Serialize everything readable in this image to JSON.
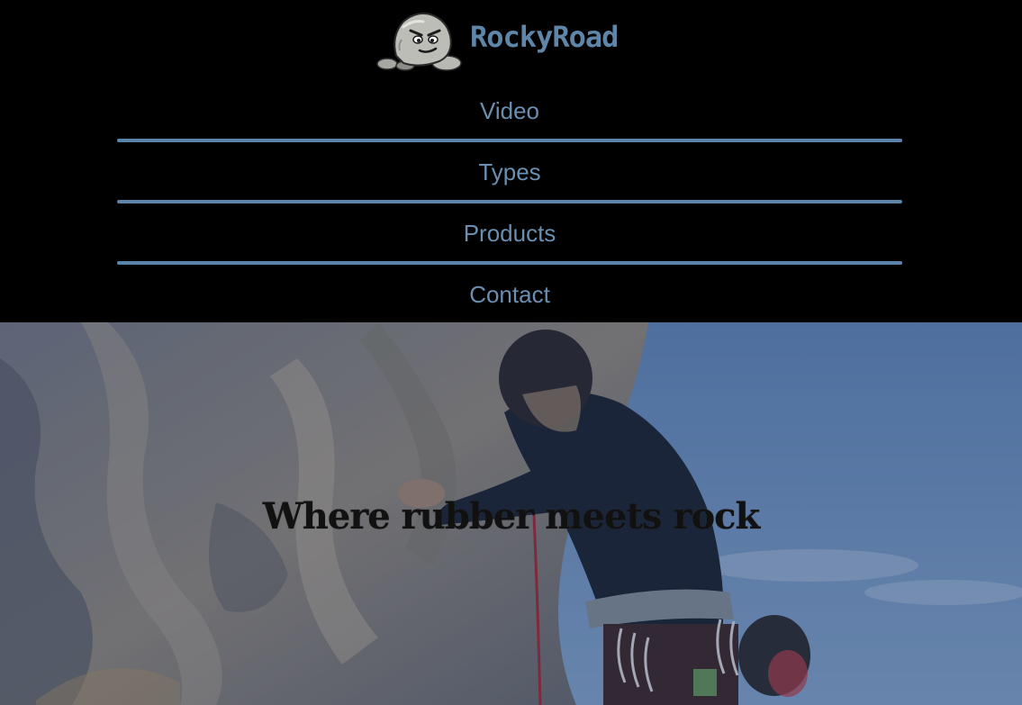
{
  "brand": {
    "name": "RockyRoad",
    "logo_icon": "rock-mascot-icon"
  },
  "nav": {
    "items": [
      {
        "label": "Video"
      },
      {
        "label": "Types"
      },
      {
        "label": "Products"
      },
      {
        "label": "Contact"
      }
    ]
  },
  "hero": {
    "tagline": "Where rubber meets rock",
    "image": "climber-on-rock-face-image"
  },
  "colors": {
    "background": "#000000",
    "accent": "#5f86a8",
    "nav_text": "#6a8fb1",
    "divider": "#5c84a8",
    "tagline": "#111111"
  }
}
